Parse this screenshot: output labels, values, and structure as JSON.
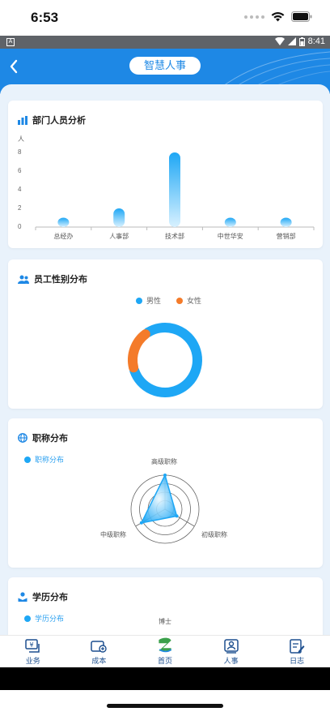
{
  "status_bar": {
    "time": "6:53",
    "android_time": "8:41",
    "android_badge": "A"
  },
  "header": {
    "title": "智慧人事"
  },
  "colors": {
    "primary": "#1e88e5",
    "male": "#1ea7f5",
    "female": "#f47b2a"
  },
  "cards": {
    "dept": {
      "title": "部门人员分析",
      "unit": "人"
    },
    "gender": {
      "title": "员工性别分布"
    },
    "title_dist": {
      "title": "职称分布"
    },
    "edu": {
      "title": "学历分布"
    }
  },
  "chart_data": [
    {
      "type": "bar",
      "categories": [
        "总经办",
        "人事部",
        "技术部",
        "中世华安",
        "营销部"
      ],
      "values": [
        1,
        2,
        8,
        1,
        1
      ],
      "ylabel": "人",
      "yticks": [
        0,
        2,
        4,
        6,
        8
      ],
      "ylim": [
        0,
        8
      ]
    },
    {
      "type": "pie",
      "style": "donut",
      "legend": [
        "男性",
        "女性"
      ],
      "values": [
        {
          "name": "男性",
          "value": 80
        },
        {
          "name": "女性",
          "value": 20
        }
      ]
    },
    {
      "type": "radar",
      "legend": [
        "职称分布"
      ],
      "indicators": [
        "高级职称",
        "初级职称",
        "中级职称"
      ],
      "series": [
        {
          "name": "职称分布",
          "values": [
            1,
            0.4,
            0.8
          ]
        }
      ]
    },
    {
      "type": "radar",
      "legend": [
        "学历分布"
      ],
      "indicators": [
        "博士"
      ]
    }
  ],
  "nav": [
    {
      "label": "业务",
      "icon": "business-icon"
    },
    {
      "label": "成本",
      "icon": "cost-icon"
    },
    {
      "label": "首页",
      "icon": "home-logo-icon"
    },
    {
      "label": "人事",
      "icon": "personnel-icon"
    },
    {
      "label": "日志",
      "icon": "log-icon"
    }
  ]
}
